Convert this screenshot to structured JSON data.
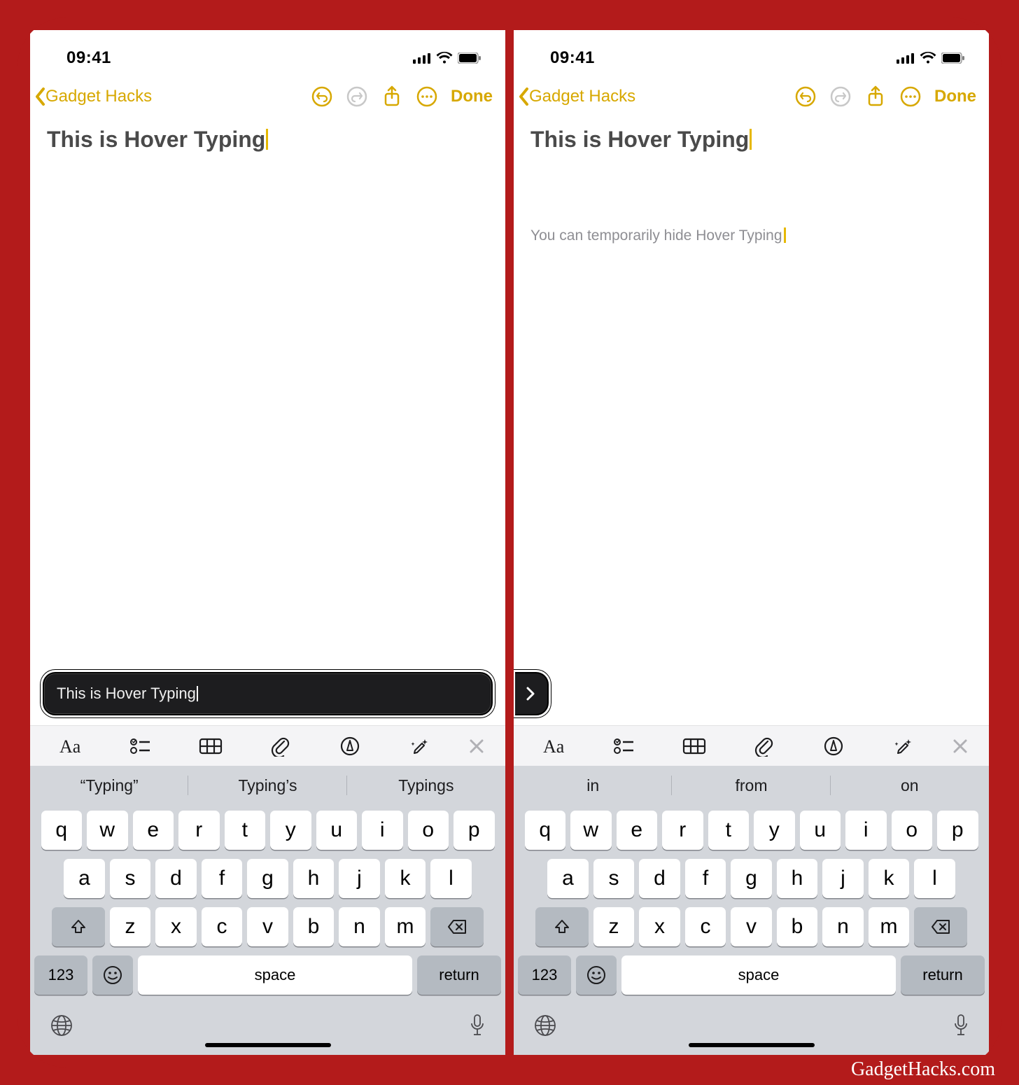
{
  "watermark": "GadgetHacks.com",
  "status": {
    "time": "09:41"
  },
  "nav": {
    "back_label": "Gadget Hacks",
    "done_label": "Done"
  },
  "left": {
    "note_title": "This is Hover Typing",
    "hover_bubble_text": "This is Hover Typing",
    "predictions": [
      "“Typing”",
      "Typing’s",
      "Typings"
    ]
  },
  "right": {
    "note_title": "This is Hover Typing",
    "note_subtext": "You can temporarily hide Hover Typing",
    "predictions": [
      "in",
      "from",
      "on"
    ]
  },
  "keyboard": {
    "row1": [
      "q",
      "w",
      "e",
      "r",
      "t",
      "y",
      "u",
      "i",
      "o",
      "p"
    ],
    "row2": [
      "a",
      "s",
      "d",
      "f",
      "g",
      "h",
      "j",
      "k",
      "l"
    ],
    "row3": [
      "z",
      "x",
      "c",
      "v",
      "b",
      "n",
      "m"
    ],
    "num_key": "123",
    "space_label": "space",
    "return_label": "return"
  }
}
